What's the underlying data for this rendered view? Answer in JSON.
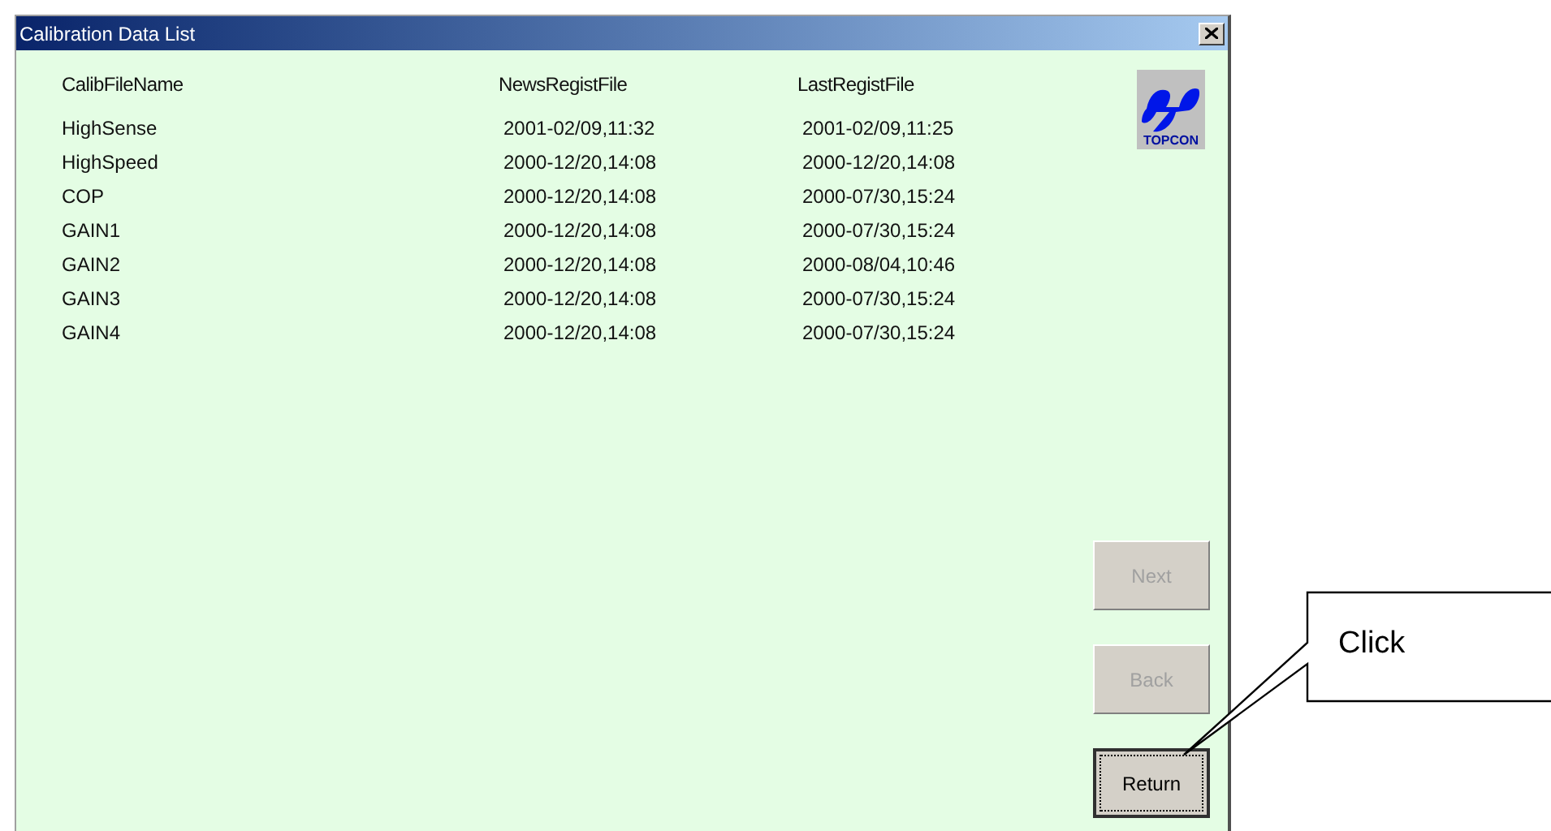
{
  "window": {
    "title": "Calibration Data List"
  },
  "table": {
    "columns": [
      "CalibFileName",
      "NewsRegistFile",
      "LastRegistFile"
    ],
    "rows": [
      [
        "HighSense",
        "2001-02/09,11:32",
        "2001-02/09,11:25"
      ],
      [
        "HighSpeed",
        "2000-12/20,14:08",
        "2000-12/20,14:08"
      ],
      [
        "COP",
        "2000-12/20,14:08",
        "2000-07/30,15:24"
      ],
      [
        "GAIN1",
        "2000-12/20,14:08",
        "2000-07/30,15:24"
      ],
      [
        "GAIN2",
        "2000-12/20,14:08",
        "2000-08/04,10:46"
      ],
      [
        "GAIN3",
        "2000-12/20,14:08",
        "2000-07/30,15:24"
      ],
      [
        "GAIN4",
        "2000-12/20,14:08",
        "2000-07/30,15:24"
      ]
    ]
  },
  "logo": {
    "text": "TOPCON"
  },
  "buttons": [
    {
      "label": "Next",
      "disabled": true,
      "focused": false
    },
    {
      "label": "Back",
      "disabled": true,
      "focused": false
    },
    {
      "label": "Return",
      "disabled": false,
      "focused": true
    }
  ],
  "callout": {
    "text": "Click"
  }
}
